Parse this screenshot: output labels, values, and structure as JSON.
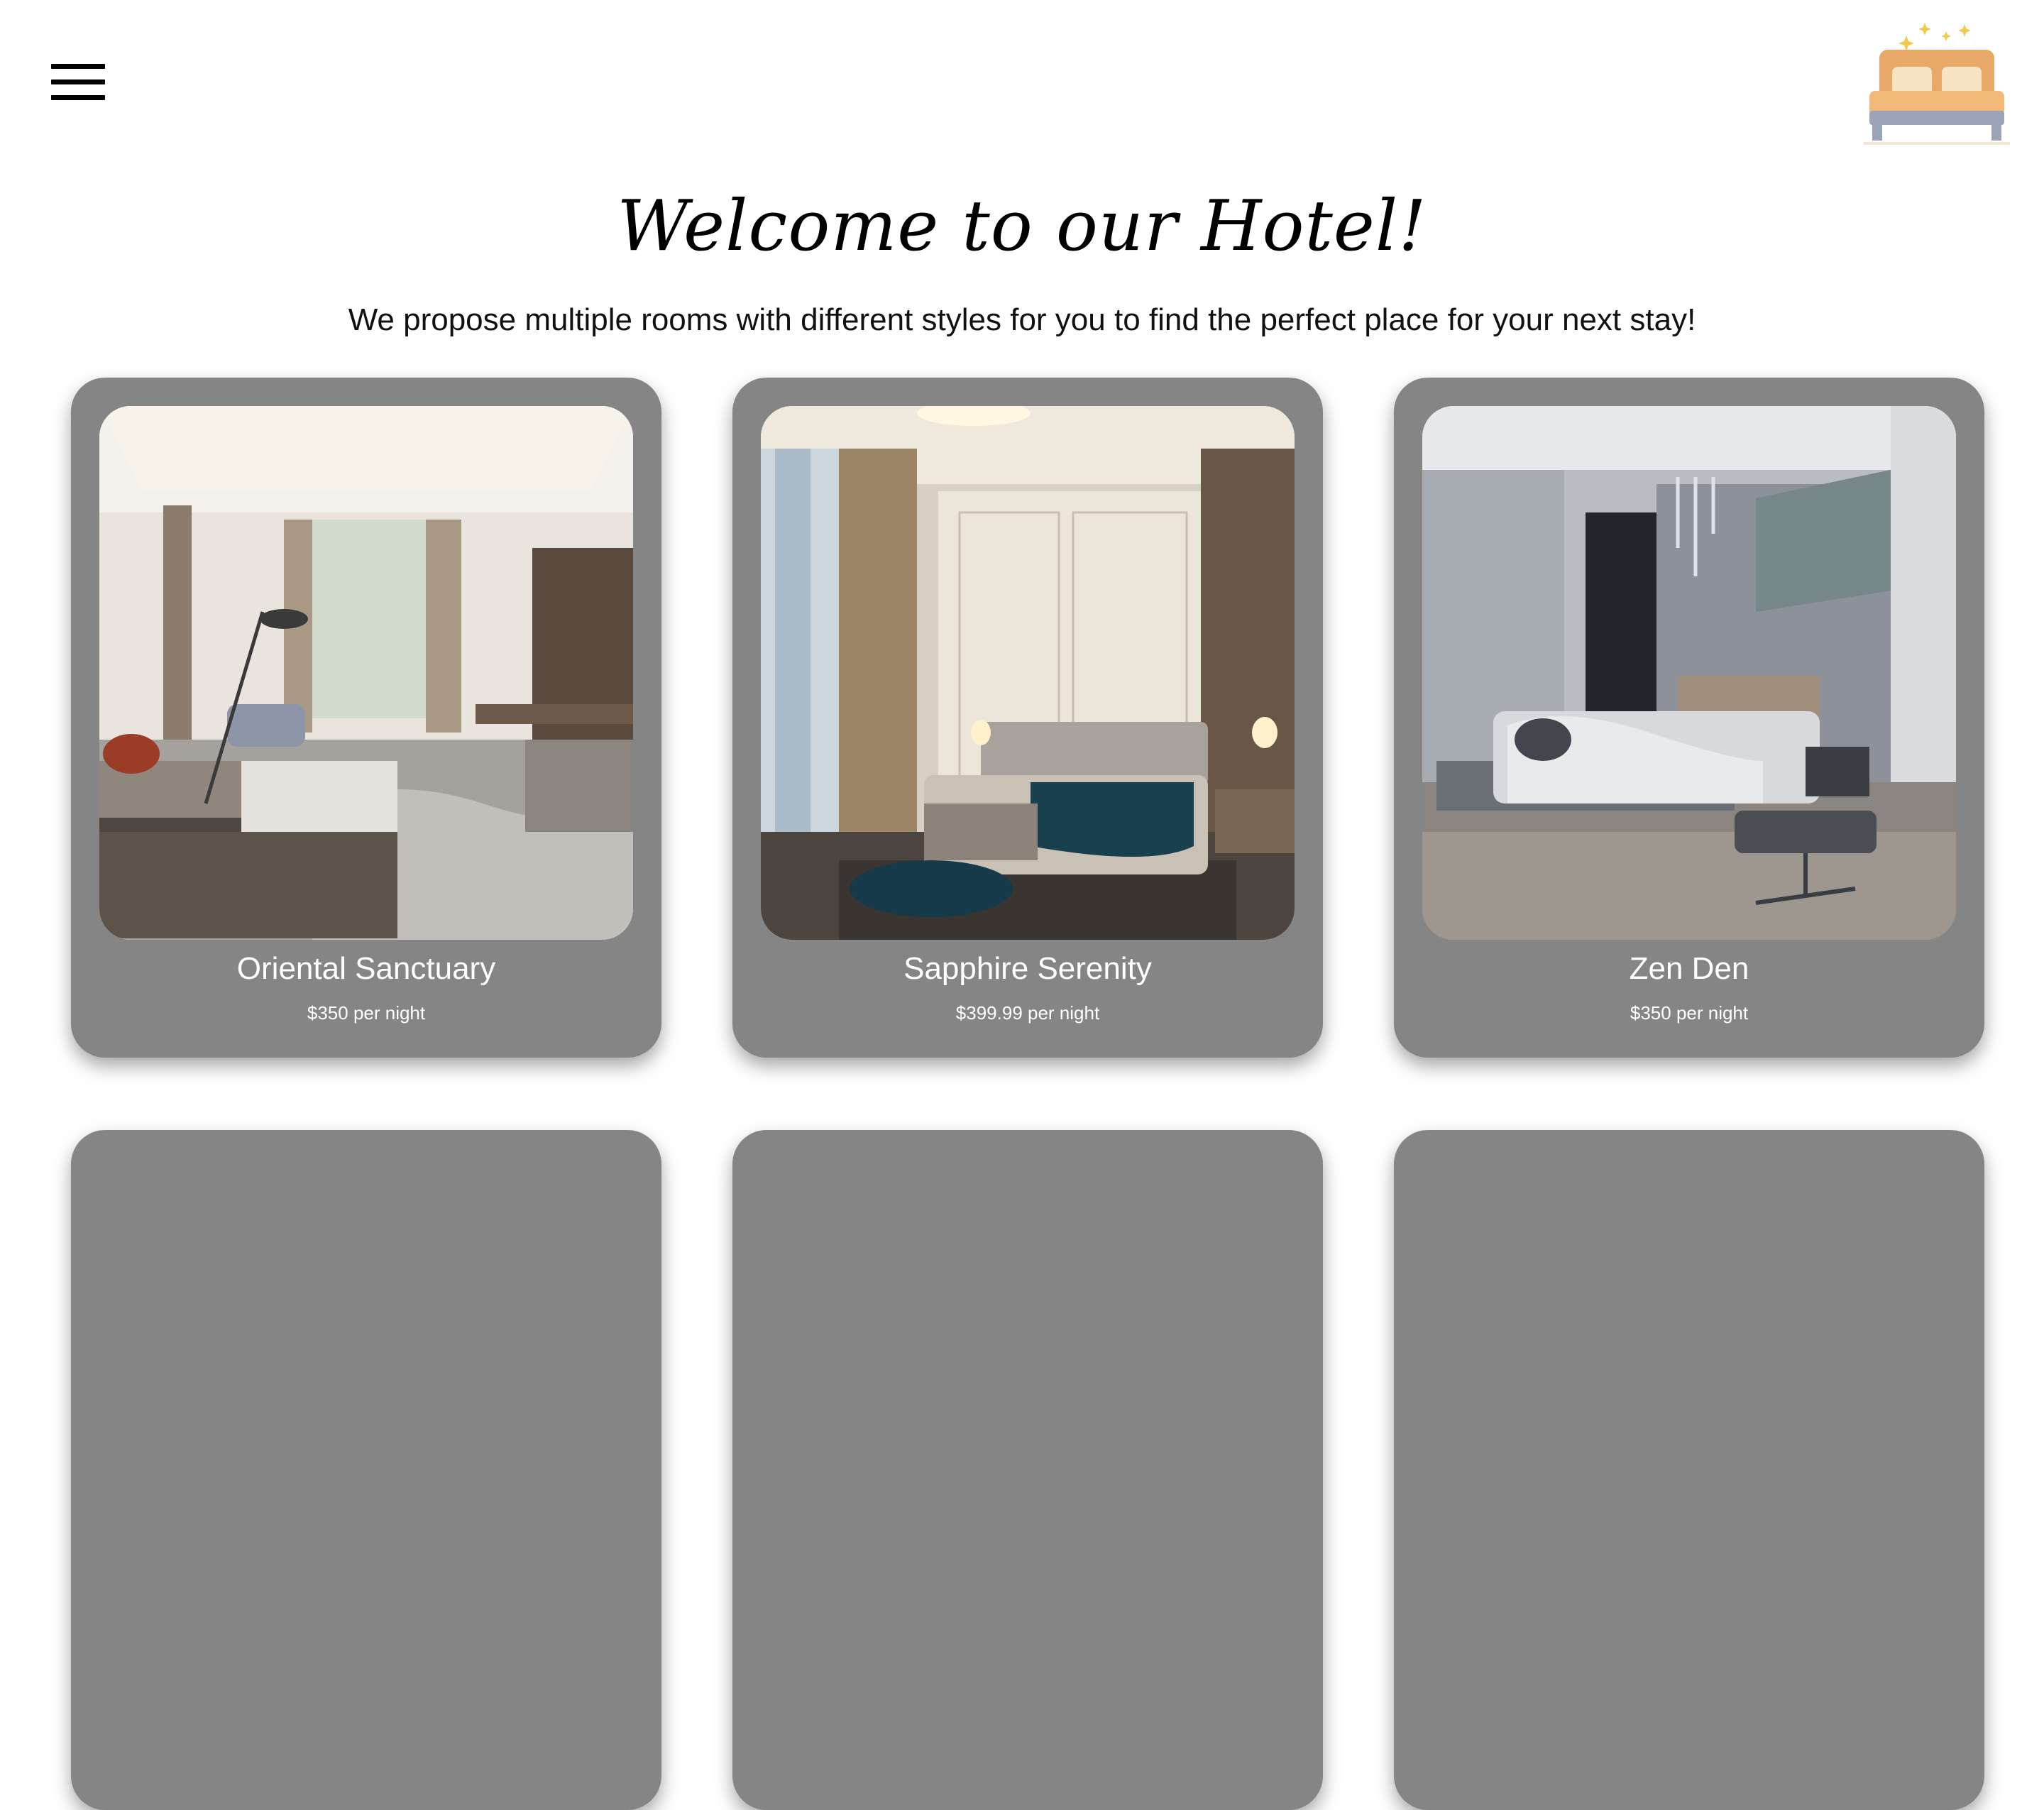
{
  "header": {
    "menu_icon": "hamburger-menu-icon",
    "logo_icon": "bed-logo-icon",
    "logo_colors": {
      "headboard": "#e8a868",
      "pillows": "#f7e3c4",
      "frame": "#f2b877",
      "base": "#9aa3b8",
      "sparkles": "#f2c94c"
    }
  },
  "hero": {
    "title": "Welcome to our Hotel!",
    "subtitle": "We propose multiple rooms with different styles for you to find the perfect place for your next stay!"
  },
  "rooms": [
    {
      "name": "Oriental Sanctuary",
      "price": "$350 per night"
    },
    {
      "name": "Sapphire Serenity",
      "price": "$399.99 per night"
    },
    {
      "name": "Zen Den",
      "price": "$350 per night"
    }
  ],
  "theme": {
    "card_bg": "#858585",
    "card_text": "#ffffff",
    "page_bg": "#ffffff"
  }
}
